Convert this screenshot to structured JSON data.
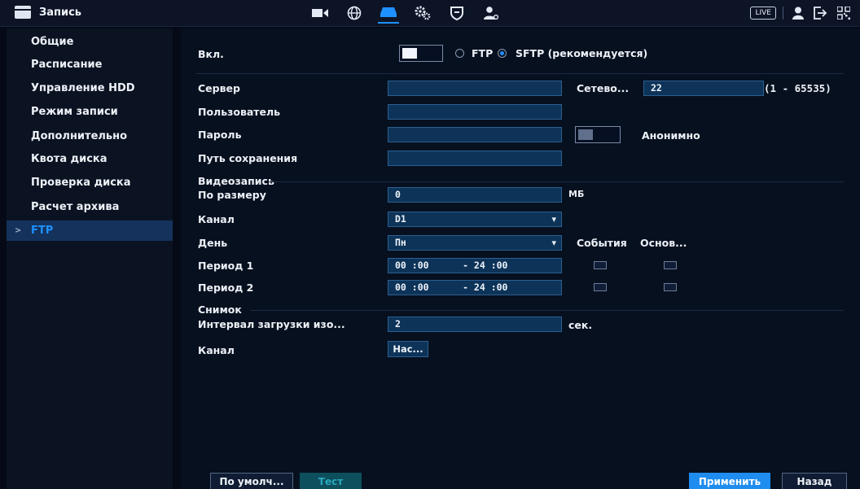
{
  "header": {
    "title": "Запись",
    "live_label": "LIVE"
  },
  "sidebar": {
    "items": [
      {
        "label": "Общие"
      },
      {
        "label": "Расписание"
      },
      {
        "label": "Управление HDD"
      },
      {
        "label": "Режим записи"
      },
      {
        "label": "Дополнительно"
      },
      {
        "label": "Квота диска"
      },
      {
        "label": "Проверка диска"
      },
      {
        "label": "Расчет архива"
      },
      {
        "label": "FTP"
      }
    ],
    "active_arrow": ">"
  },
  "form": {
    "enable_label": "Вкл.",
    "ftp_label": "FTP",
    "sftp_label": "SFTP (рекомендуется)",
    "server_label": "Сервер",
    "server_value": "",
    "port_label": "Сетево...",
    "port_value": "22",
    "port_range": "(1 - 65535)",
    "user_label": "Пользователь",
    "user_value": "",
    "password_label": "Пароль",
    "password_value": "",
    "anonymous_label": "Анонимно",
    "path_label": "Путь сохранения",
    "path_value": "",
    "video_section": "Видеозапись",
    "size_label": "По размеру",
    "size_value": "0",
    "size_unit": "МБ",
    "channel_label": "Канал",
    "channel_value": "D1",
    "day_label": "День",
    "day_value": "Пн",
    "events_label": "События",
    "main_label": "Основ...",
    "period1_label": "Период 1",
    "period1_value": "00 :00      - 24 :00",
    "period2_label": "Период 2",
    "period2_value": "00 :00      - 24 :00",
    "snapshot_section": "Снимок",
    "interval_label": "Интервал загрузки изо...",
    "interval_value": "2",
    "interval_unit": "сек.",
    "snap_channel_label": "Канал",
    "snap_channel_button": "Нас..."
  },
  "footer": {
    "default_label": "По умолч...",
    "test_label": "Тест",
    "apply_label": "Применить",
    "back_label": "Назад"
  },
  "colors": {
    "accent": "#1e90ff",
    "field_bg": "#0d3358",
    "background": "#07101f"
  },
  "icons": [
    "menu-icon",
    "camera-icon",
    "network-icon",
    "storage-icon",
    "settings-icon",
    "shield-icon",
    "account-icon",
    "user-icon",
    "logout-icon",
    "qr-icon"
  ]
}
